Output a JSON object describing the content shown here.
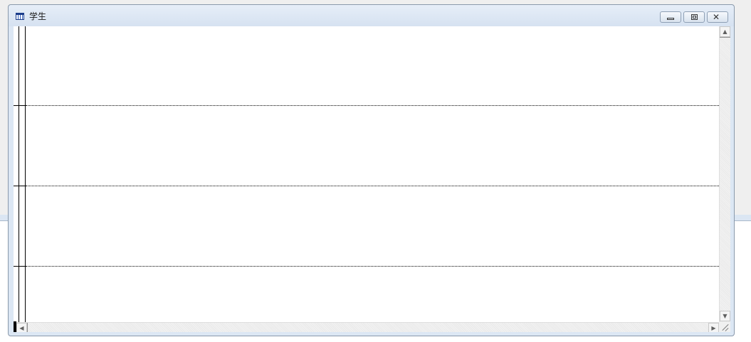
{
  "window": {
    "title": "学生",
    "title_icon": "datasheet-table-icon",
    "controls": {
      "minimize": "minimize-icon",
      "restore": "restore-icon",
      "close": "close-icon"
    }
  },
  "datasheet": {
    "visible_rows": 4,
    "record_selector_active_row": 4
  },
  "scrollbars": {
    "vertical_up": "▲",
    "vertical_down": "▼",
    "horizontal_left": "◀",
    "horizontal_right": "▶"
  },
  "colors": {
    "titlebar": "#dce7f4",
    "window_border": "#8a99ab",
    "grid_line": "#000000",
    "client_background": "#ffffff"
  }
}
